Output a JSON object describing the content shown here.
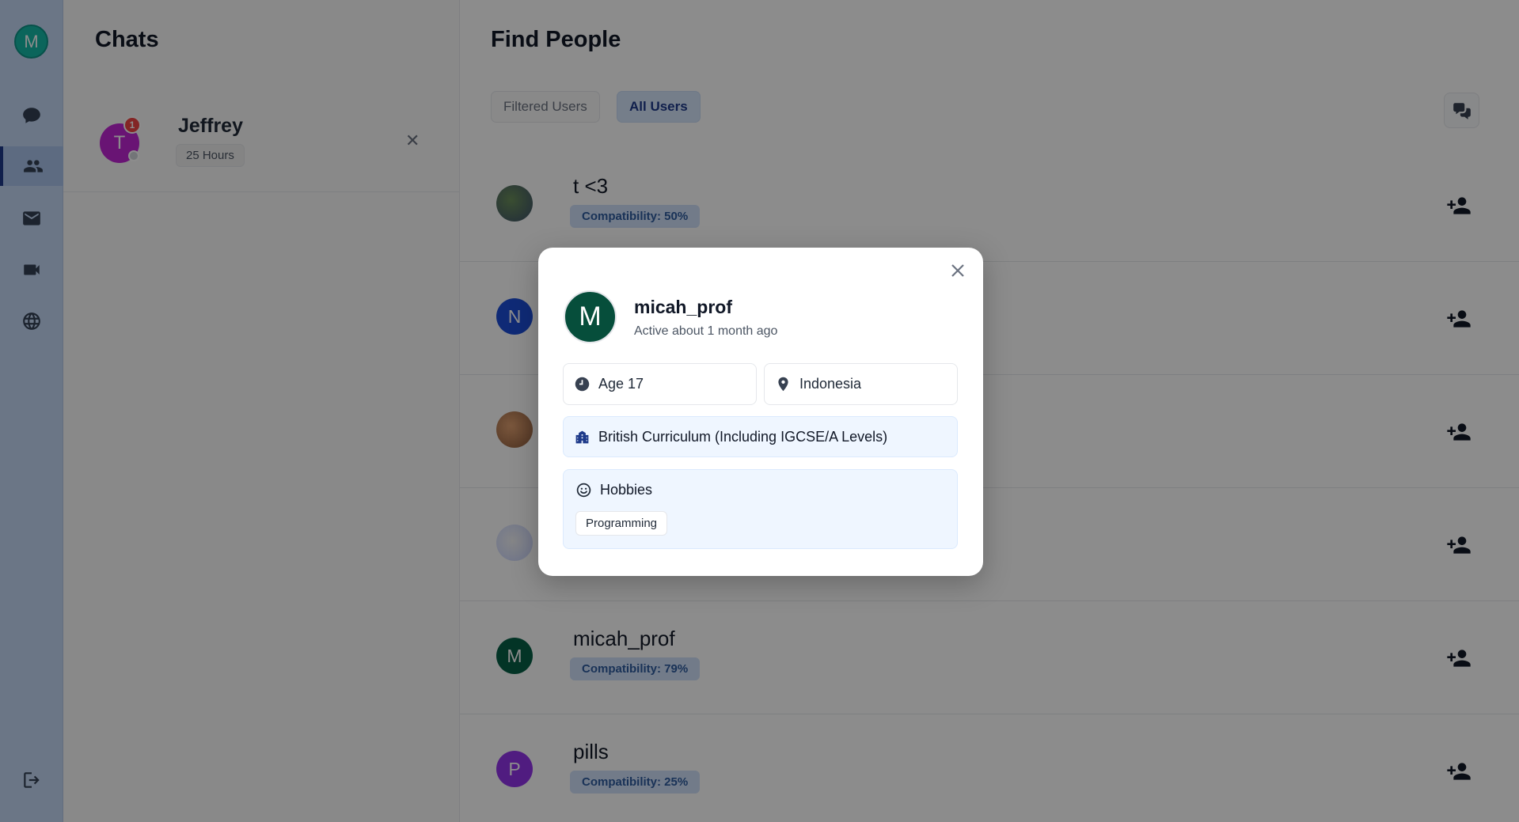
{
  "rail": {
    "me_initial": "M",
    "items": [
      {
        "name": "chats",
        "icon": "chat-bubble-icon"
      },
      {
        "name": "people",
        "icon": "people-icon",
        "active": true
      },
      {
        "name": "mail",
        "icon": "mail-icon"
      },
      {
        "name": "video",
        "icon": "video-icon"
      },
      {
        "name": "globe",
        "icon": "globe-icon"
      }
    ],
    "logout_icon": "logout-icon"
  },
  "chats": {
    "title": "Chats",
    "items": [
      {
        "initial": "T",
        "name": "Jeffrey",
        "time": "25 Hours",
        "unread": "1"
      }
    ]
  },
  "main": {
    "title": "Find People",
    "tabs": [
      {
        "label": "Filtered Users"
      },
      {
        "label": "All Users",
        "active": true
      }
    ],
    "users": [
      {
        "name": "t <3",
        "compat": "Compatibility: 50%",
        "initial": ""
      },
      {
        "name": "",
        "compat": "",
        "initial": "N"
      },
      {
        "name": "",
        "compat": "",
        "initial": ""
      },
      {
        "name": "",
        "compat": "",
        "initial": ""
      },
      {
        "name": "micah_prof",
        "compat": "Compatibility: 79%",
        "initial": "M"
      },
      {
        "name": "pills",
        "compat": "Compatibility: 25%",
        "initial": "P"
      }
    ]
  },
  "modal": {
    "initial": "M",
    "name": "micah_prof",
    "status": "Active about 1 month ago",
    "age": "Age 17",
    "location": "Indonesia",
    "curriculum": "British Curriculum (Including IGCSE/A Levels)",
    "hobbies_label": "Hobbies",
    "hobbies": [
      "Programming"
    ]
  },
  "colors": {
    "rail_bg": "#c4d8f5",
    "accent": "#1e3a8a",
    "compat_bg": "#cfe0fa",
    "modal_avatar": "#064e3b"
  }
}
